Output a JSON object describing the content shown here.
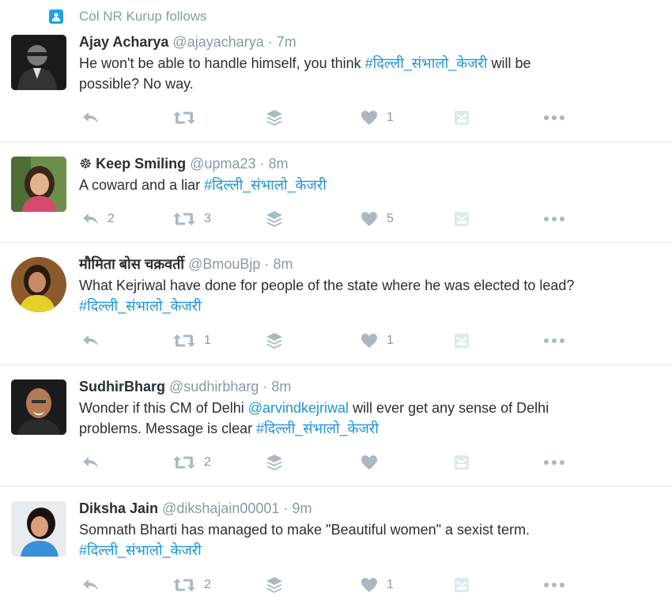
{
  "context": {
    "text": "Col NR Kurup follows"
  },
  "tweets": [
    {
      "name": "Ajay Acharya",
      "handle": "@ajayacharya",
      "dot": "·",
      "time": "7m",
      "text_line1_a": "He won't be able to handle himself, you think ",
      "hashtag": "#दिल्ली_संभालो_केजरी",
      "text_line1_b": " will be",
      "text_line2": "possible? No way.",
      "retweets": "",
      "likes": "1",
      "replies": ""
    },
    {
      "name_prefix": "☸",
      "name": "Keep Smiling",
      "handle": "@upma23",
      "dot": "·",
      "time": "8m",
      "text_a": "A coward and a liar ",
      "hashtag": "#दिल्ली_संभालो_केजरी",
      "replies": "2",
      "retweets": "3",
      "likes": "5"
    },
    {
      "name": "मौमिता बोस चक्रवर्ती",
      "handle": "@BmouBjp",
      "dot": "·",
      "time": "8m",
      "text_line1": "What Kejriwal have done for people of the state where he was elected to lead?",
      "hashtag": "#दिल्ली_संभालो_केजरी",
      "replies": "",
      "retweets": "1",
      "likes": "1"
    },
    {
      "name": "SudhirBharg",
      "handle": "@sudhirbharg",
      "dot": "·",
      "time": "8m",
      "text_line1_a": "Wonder if this CM of Delhi ",
      "mention": "@arvindkejriwal",
      "text_line1_b": " will ever get any sense of Delhi",
      "text_line2_a": "problems. Message is clear ",
      "hashtag": "#दिल्ली_संभालो_केजरी",
      "replies": "",
      "retweets": "2",
      "likes": ""
    },
    {
      "name": "Diksha Jain",
      "handle": "@dikshajain00001",
      "dot": "·",
      "time": "9m",
      "text_line1": "Somnath Bharti has managed to make \"Beautiful women\" a sexist term.",
      "hashtag": "#दिल्ली_संभालो_केजरी",
      "replies": "",
      "retweets": "2",
      "likes": "1"
    }
  ],
  "colors": {
    "link": "#1b95e0",
    "muted": "#8899a6",
    "icon": "#aab8c2",
    "divider": "#e1e8ed"
  }
}
